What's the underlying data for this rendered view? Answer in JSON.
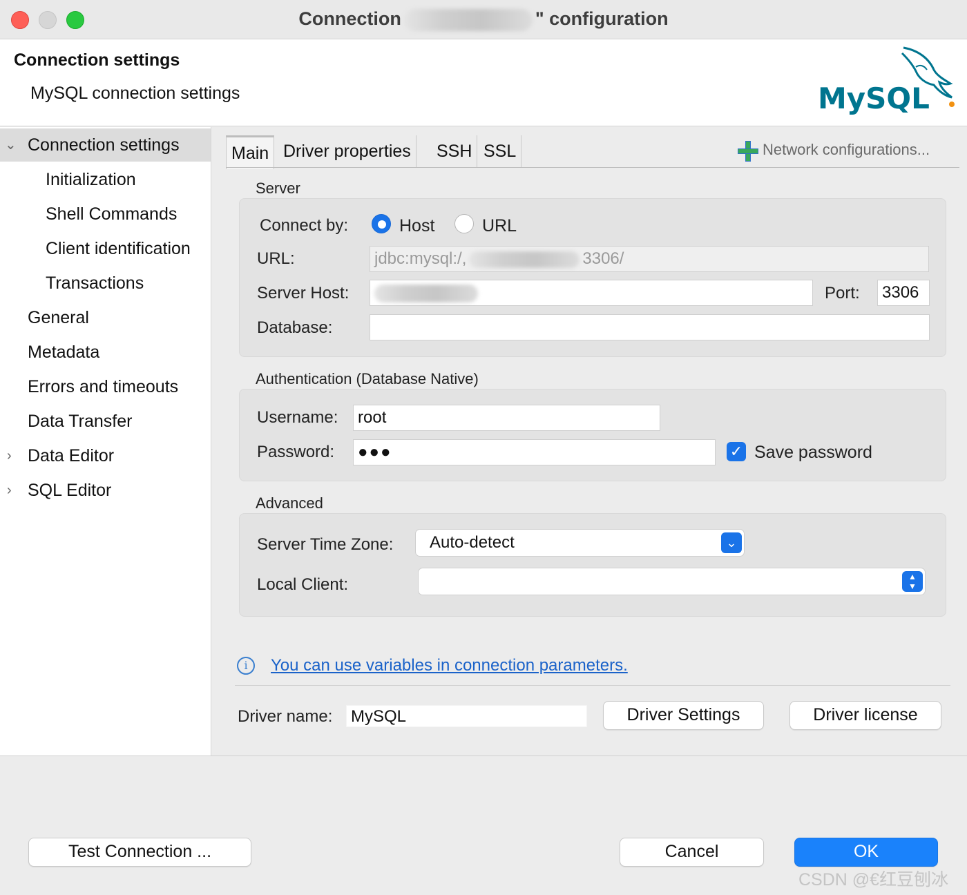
{
  "window": {
    "title_prefix": "Connection",
    "title_suffix": "\" configuration"
  },
  "header": {
    "title": "Connection settings",
    "subtitle": "MySQL connection settings",
    "logo_text": "MySQL"
  },
  "sidebar": {
    "items": [
      {
        "label": "Connection settings",
        "caret": "chevron-down-icon"
      },
      {
        "label": "Initialization"
      },
      {
        "label": "Shell Commands"
      },
      {
        "label": "Client identification"
      },
      {
        "label": "Transactions"
      },
      {
        "label": "General"
      },
      {
        "label": "Metadata"
      },
      {
        "label": "Errors and timeouts"
      },
      {
        "label": "Data Transfer"
      },
      {
        "label": "Data Editor",
        "caret": "chevron-right-icon"
      },
      {
        "label": "SQL Editor",
        "caret": "chevron-right-icon"
      }
    ]
  },
  "tabs": [
    "Main",
    "Driver properties",
    "SSH",
    "SSL"
  ],
  "network_configurations": "Network configurations...",
  "server": {
    "group_title": "Server",
    "connect_by_label": "Connect by:",
    "option_host": "Host",
    "option_url": "URL",
    "url_label": "URL:",
    "url_value_start": "jdbc:mysql:/,",
    "url_value_end": "3306/",
    "host_label": "Server Host:",
    "port_label": "Port:",
    "port_value": "3306",
    "database_label": "Database:",
    "database_value": ""
  },
  "auth": {
    "group_title": "Authentication (Database Native)",
    "username_label": "Username:",
    "username_value": "root",
    "password_label": "Password:",
    "password_value": "●●●",
    "save_password_label": "Save password",
    "save_password_checked": true
  },
  "advanced": {
    "group_title": "Advanced",
    "timezone_label": "Server Time Zone:",
    "timezone_value": "Auto-detect",
    "local_client_label": "Local Client:",
    "local_client_value": ""
  },
  "info_link": "You can use variables in connection parameters.",
  "driver": {
    "name_label": "Driver name:",
    "name_value": "MySQL",
    "settings_button": "Driver Settings",
    "license_button": "Driver license"
  },
  "footer": {
    "test_button": "Test Connection ...",
    "cancel_button": "Cancel",
    "ok_button": "OK"
  },
  "watermark": "CSDN @€红豆刨冰",
  "colors": {
    "accent": "#1a73e8",
    "ok_button": "#1a82fb",
    "link": "#1a62c9",
    "mysql_blue": "#00758f",
    "mysql_orange": "#f29111"
  }
}
